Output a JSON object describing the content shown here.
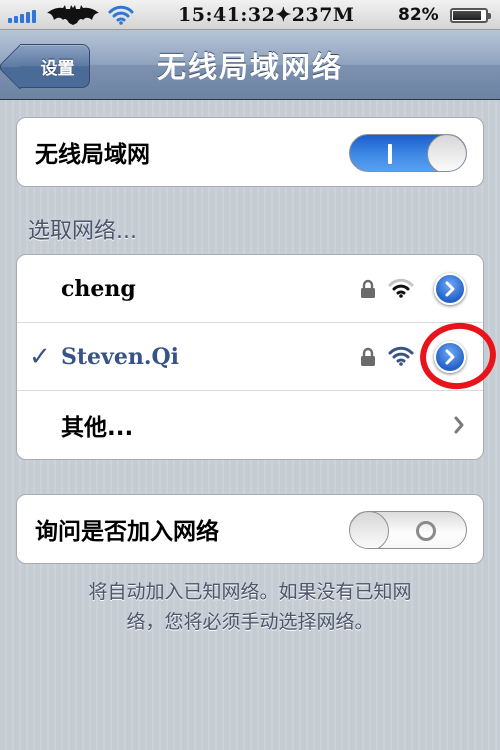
{
  "status_bar": {
    "time": "15:41:32✦237M",
    "battery_percent": "82%",
    "battery_level": 0.82,
    "signal_bars": 5,
    "carrier_icon": "bat-logo-icon",
    "wifi_icon": "wifi-icon"
  },
  "nav": {
    "back_label": "设置",
    "title": "无线局域网络"
  },
  "wifi_toggle": {
    "label": "无线局域网",
    "state": "on"
  },
  "networks": {
    "header": "选取网络...",
    "items": [
      {
        "name": "cheng",
        "selected": false,
        "locked": true,
        "signal": "medium"
      },
      {
        "name": "Steven.Qi",
        "selected": true,
        "locked": true,
        "signal": "full"
      }
    ],
    "other_label": "其他...",
    "checkmark": "✓"
  },
  "ask_join": {
    "label": "询问是否加入网络",
    "state": "off"
  },
  "footer": {
    "line1": "将自动加入已知网络。如果没有已知网",
    "line2": "络，您将必须手动选择网络。"
  },
  "colors": {
    "accent_blue": "#385487",
    "toggle_on": "#3f8ae6",
    "annotation_red": "#e8131b"
  }
}
